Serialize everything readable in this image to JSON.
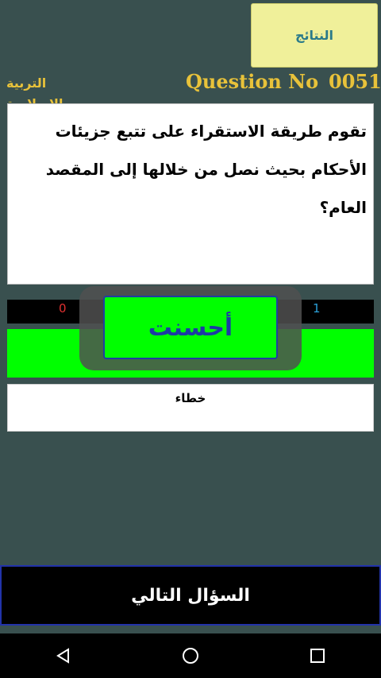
{
  "header": {
    "results_label": "النتائج",
    "subject": "التربية الإسلامية",
    "question_label": "Question No",
    "question_number": "0051"
  },
  "question": {
    "text": "تقوم طريقة الاستقراء على تتبع جزيئات الأحكام بحيث نصل من خلالها إلى المقصد العام؟"
  },
  "score": {
    "wrong": "0",
    "right": "1"
  },
  "answer": {
    "text": "خطاء"
  },
  "feedback": {
    "text": "أحسنت"
  },
  "footer": {
    "next_label": "السؤال التالي"
  },
  "navbar": {
    "icons": [
      "back-icon",
      "home-icon",
      "recents-icon"
    ]
  }
}
